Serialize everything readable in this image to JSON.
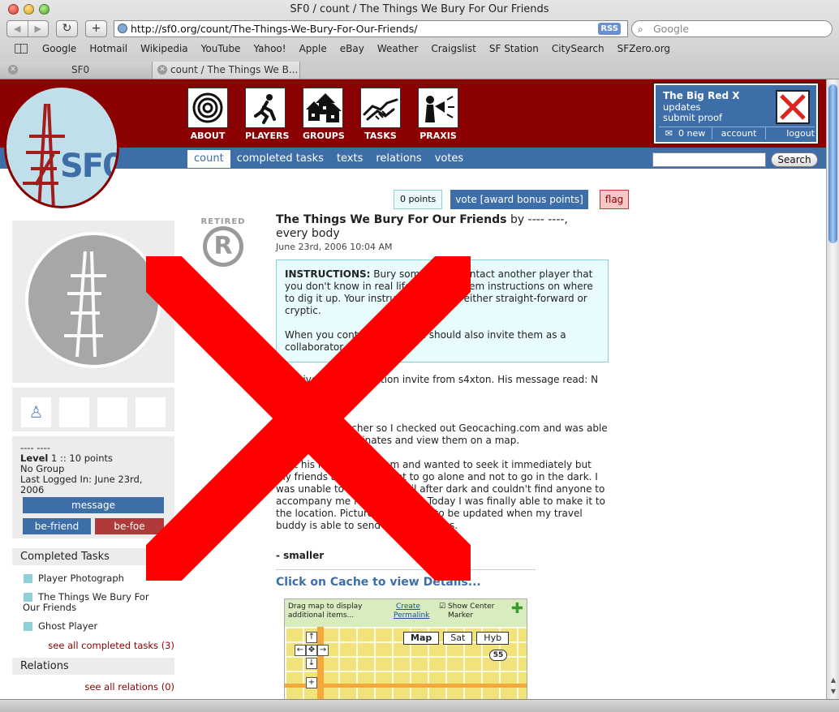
{
  "window": {
    "title": "SF0 / count / The Things We Bury For Our Friends"
  },
  "toolbar": {
    "back_glyph": "◀",
    "forward_glyph": "▶",
    "reload_glyph": "↻",
    "newtab_glyph": "+",
    "url": "http://sf0.org/count/The-Things-We-Bury-For-Our-Friends/",
    "rss_label": "RSS",
    "search_placeholder": "Google"
  },
  "bookmarks": [
    "Google",
    "Hotmail",
    "Wikipedia",
    "YouTube",
    "Yahoo!",
    "Apple",
    "eBay",
    "Weather",
    "Craigslist",
    "SF Station",
    "CitySearch",
    "SFZero.org"
  ],
  "tabs": [
    {
      "label": "SF0"
    },
    {
      "label": "count / The Things We B..."
    }
  ],
  "site": {
    "logo_text": "SF0",
    "nav": [
      {
        "label": "ABOUT",
        "icon": "target-icon"
      },
      {
        "label": "PLAYERS",
        "icon": "runner-icon"
      },
      {
        "label": "GROUPS",
        "icon": "houses-icon"
      },
      {
        "label": "TASKS",
        "icon": "handshake-icon"
      },
      {
        "label": "PRAXIS",
        "icon": "megaphone-icon"
      }
    ],
    "subnav": [
      "count",
      "completed tasks",
      "texts",
      "relations",
      "votes"
    ],
    "search_button": "Search"
  },
  "userbox": {
    "name": "The Big Red X",
    "links": [
      "updates",
      "submit proof"
    ],
    "new_count": "0 new",
    "account": "account",
    "logout": "logout"
  },
  "sidebar": {
    "player_name": "---- ----",
    "level_label": "Level",
    "level_value": "1",
    "points_text": ":: 10 points",
    "group": "No Group",
    "last_logged": "Last Logged In: June 23rd, 2006",
    "message_btn": "message",
    "befriend_btn": "be-friend",
    "befoe_btn": "be-foe",
    "completed_heading": "Completed Tasks",
    "completed_tasks": [
      "Player Photograph",
      "The Things We Bury For Our Friends",
      "Ghost Player"
    ],
    "see_all_completed": "see all completed tasks (3)",
    "relations_heading": "Relations",
    "see_all_relations": "see all relations (0)"
  },
  "main": {
    "points": "0 points",
    "vote": "vote [award bonus points]",
    "flag": "flag",
    "retired_label": "RETIRED",
    "retired_mark": "R",
    "title": "The Things We Bury For Our Friends",
    "by": "by ---- ----,",
    "byline2": "every body",
    "date": "June 23rd, 2006 10:04 AM",
    "instructions_label": "INSTRUCTIONS:",
    "instructions_p1": "Bury something. Contact another player that you don't know in real life and give them instructions on where to dig it up. Your instructions can be either straight-forward or cryptic.",
    "instructions_p2": "When you contact them, you should also invite them as a collaborator on this task.",
    "body": [
      "I received a collaboration invite from s4xton. His message read: N 37° 57...",
      "I'm not a geocacher so I checked out Geocaching.com and was able to enter his coordinates and view them on a map.",
      "I got his message at 2am and wanted to seek it immediately but my friends advised me not to go alone and not to go in the dark. I was unable to get there until after dark and couldn't find anyone to accompany me for two nights. Today I was finally able to make it to the location. Pictures follow and to be updated when my travel buddy is able to send me our photos."
    ],
    "smaller": "- smaller",
    "map_link": "Click on Cache to view Details...",
    "map": {
      "hint": "Drag map to display additional items...",
      "permalink": "Create Permalink",
      "show_center": "Show Center Marker",
      "buttons": [
        "Map",
        "Sat",
        "Hyb"
      ],
      "highway": "55"
    }
  },
  "colors": {
    "brand_red": "#8b0000",
    "brand_blue": "#3e6ea8",
    "cross_red": "#ff0000"
  }
}
